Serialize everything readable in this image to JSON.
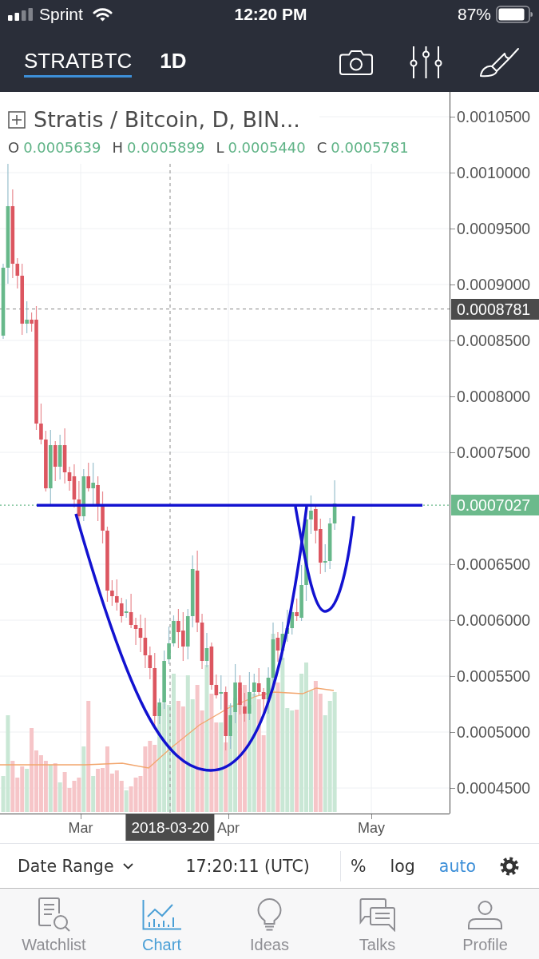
{
  "status_bar": {
    "carrier": "Sprint",
    "time": "12:20 PM",
    "battery": "87%"
  },
  "toolbar": {
    "items": [
      {
        "kind": "symbol",
        "label": "STRATBTC",
        "selected": true
      },
      {
        "kind": "interval",
        "label": "1D",
        "selected": false
      }
    ]
  },
  "chart": {
    "title": "Stratis / Bitcoin, D, BIN...",
    "legend": [
      {
        "label": "O",
        "value": "0.0005639"
      },
      {
        "label": "H",
        "value": "0.0005899"
      },
      {
        "label": "L",
        "value": "0.0005440"
      },
      {
        "label": "C",
        "value": "0.0005781"
      }
    ],
    "price_axis": {
      "ticks": [
        "0.0010500",
        "0.0010000",
        "0.0009500",
        "0.0009000",
        "0.0008500",
        "0.0008000",
        "0.0007500",
        "0.0006500",
        "0.0006000",
        "0.0005500",
        "0.0005000",
        "0.0004500"
      ],
      "crosshair_price": "0.0008781",
      "last_price": "0.0007027"
    },
    "time_axis": {
      "ticks": [
        "Mar",
        "Apr",
        "May"
      ],
      "crosshair_date": "2018-03-20"
    }
  },
  "bottom_bar": {
    "date_range": "Date Range",
    "clock": "17:20:11 (UTC)",
    "scale_options": [
      {
        "label": "%",
        "on": false
      },
      {
        "label": "log",
        "on": false
      },
      {
        "label": "auto",
        "on": true
      }
    ]
  },
  "tab_bar": {
    "tabs": [
      {
        "label": "Watchlist",
        "selected": false
      },
      {
        "label": "Chart",
        "selected": true
      },
      {
        "label": "Ideas",
        "selected": false
      },
      {
        "label": "Talks",
        "selected": false
      },
      {
        "label": "Profile",
        "selected": false
      }
    ]
  }
}
